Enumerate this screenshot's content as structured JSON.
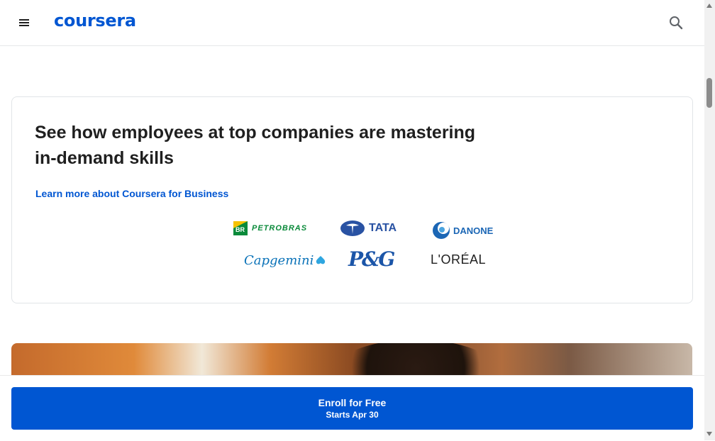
{
  "header": {
    "menu_icon": "hamburger-menu-icon",
    "logo_text": "coursera",
    "search_icon": "search-icon"
  },
  "business_card": {
    "title": "See how employees at top companies are mastering in-demand skills",
    "link_text": "Learn more about Coursera for Business",
    "companies": [
      "PETROBRAS",
      "TATA",
      "DANONE",
      "Capgemini",
      "P&G",
      "L'ORÉAL"
    ]
  },
  "enroll": {
    "main_label": "Enroll for Free",
    "sub_label": "Starts Apr 30"
  },
  "colors": {
    "brand_blue": "#0056d2",
    "border": "#e1e4e7"
  }
}
